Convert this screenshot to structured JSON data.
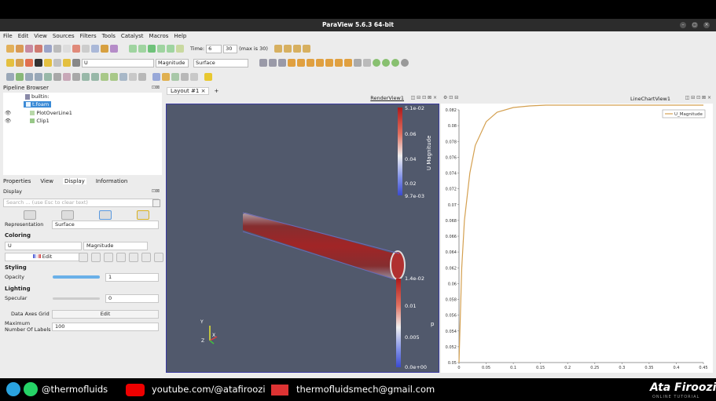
{
  "window": {
    "title": "ParaView 5.6.3 64-bit"
  },
  "menu": [
    "File",
    "Edit",
    "View",
    "Sources",
    "Filters",
    "Tools",
    "Catalyst",
    "Macros",
    "Help"
  ],
  "toolbar": {
    "time_label": "Time:",
    "time_value": "6",
    "frame_value": "30",
    "max_label": "(max is 30)",
    "variable": "U",
    "component": "Magnitude",
    "representation": "Surface"
  },
  "pipeline": {
    "title": "Pipeline Browser",
    "items": [
      "builtin:",
      "t.foam",
      "PlotOverLine1",
      "Clip1"
    ]
  },
  "props_tabs": [
    "Properties",
    "View",
    "Display",
    "Information"
  ],
  "display": {
    "header": "Display",
    "search_placeholder": "Search ... (use Esc to clear text)",
    "representation_label": "Representation",
    "representation_value": "Surface",
    "coloring_label": "Coloring",
    "color_var": "U",
    "color_comp": "Magnitude",
    "edit_label": "Edit",
    "styling_label": "Styling",
    "opacity_label": "Opacity",
    "opacity_value": "1",
    "lighting_label": "Lighting",
    "specular_label": "Specular",
    "specular_value": "0",
    "axes_grid_label": "Data Axes Grid",
    "axes_grid_edit": "Edit",
    "max_labels_label": "Maximum Number Of Labels",
    "max_labels_value": "100"
  },
  "layout": {
    "tab": "Layout #1",
    "plus": "+"
  },
  "render": {
    "title": "RenderView1",
    "bar1": {
      "title": "U Magnitude",
      "labels": [
        "5.1e-02",
        "0.06",
        "0.04",
        "0.02",
        "9.7e-03"
      ]
    },
    "bar2": {
      "title": "p",
      "labels": [
        "1.4e-02",
        "0.01",
        "0.005",
        "0.0e+00"
      ]
    },
    "axes": {
      "x": "X",
      "y": "Y",
      "z": "Z"
    }
  },
  "chart": {
    "title": "LineChartView1"
  },
  "chart_data": {
    "type": "line",
    "series": [
      {
        "name": "U_Magnitude",
        "color": "#d4a050",
        "x": [
          0,
          0.005,
          0.01,
          0.02,
          0.03,
          0.05,
          0.07,
          0.1,
          0.13,
          0.16,
          0.2,
          0.25,
          0.3,
          0.35,
          0.4,
          0.45
        ],
        "y": [
          0.05,
          0.062,
          0.068,
          0.074,
          0.0775,
          0.0805,
          0.0817,
          0.0823,
          0.0825,
          0.0826,
          0.0826,
          0.0826,
          0.0826,
          0.0826,
          0.0826,
          0.0826
        ]
      }
    ],
    "xlim": [
      0,
      0.45
    ],
    "ylim": [
      0.05,
      0.082
    ],
    "xticks": [
      "0",
      "0.05",
      "0.1",
      "0.15",
      "0.2",
      "0.25",
      "0.3",
      "0.35",
      "0.4",
      "0.45"
    ],
    "yticks": [
      "0.082",
      "0.08",
      "0.078",
      "0.076",
      "0.074",
      "0.072",
      "0.07",
      "0.068",
      "0.066",
      "0.064",
      "0.062",
      "0.06",
      "0.058",
      "0.056",
      "0.054",
      "0.052",
      "0.05"
    ],
    "legend": "top-right",
    "grid": false
  },
  "footer": {
    "telegram_handle": "@thermofluids",
    "youtube": "youtube.com/@atafiroozi",
    "email": "thermofluidsmech@gmail.com",
    "brand_first": "Ata",
    "brand_last": "Firoozi",
    "brand_sub": "ONLINE TUTORIAL"
  }
}
